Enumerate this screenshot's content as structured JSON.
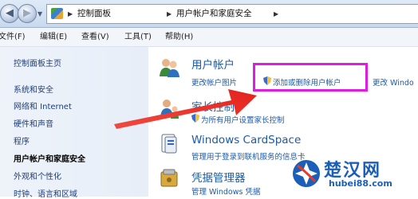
{
  "address_bar": {
    "crumbs": [
      "控制面板",
      "用户帐户和家庭安全"
    ]
  },
  "menu_bar": {
    "items": [
      "文件(F)",
      "编辑(E)",
      "查看(V)",
      "工具(T)",
      "帮助(H)"
    ]
  },
  "left_nav": {
    "items": [
      "控制面板主页",
      "系统和安全",
      "网络和 Internet",
      "硬件和声音",
      "程序",
      "用户帐户和家庭安全",
      "外观和个性化",
      "时钟、语言和区域"
    ],
    "current_index": 5
  },
  "categories": [
    {
      "title": "用户帐户",
      "links": [
        "更改帐户图片",
        "添加或删除用户帐户",
        "更改 Windo"
      ],
      "icon": "users-icon"
    },
    {
      "title": "家长控制",
      "links": [
        "为所有用户设置家长控制"
      ],
      "icon": "parental-controls-icon"
    },
    {
      "title": "Windows CardSpace",
      "links": [
        "管理用于登录到联机服务的信息卡"
      ],
      "icon": "cardspace-icon"
    },
    {
      "title": "凭据管理器",
      "links": [
        "管理 Windows 凭据"
      ],
      "icon": "credential-manager-icon"
    }
  ],
  "annotation": {
    "highlight_color": "#e01ce0",
    "arrow_color": "#e8312a"
  },
  "watermark": {
    "title": "楚汉网",
    "url": "hubei88.com"
  }
}
